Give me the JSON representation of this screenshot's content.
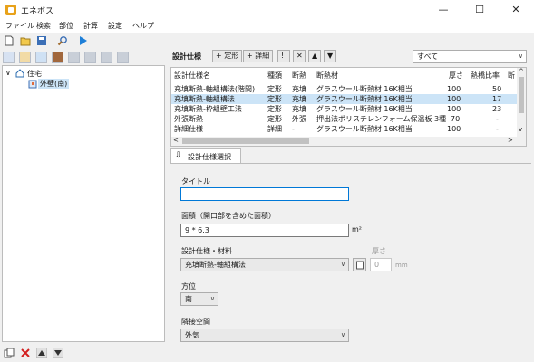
{
  "window": {
    "title": "エネボス",
    "min": "—",
    "max": "☐",
    "close": "✕"
  },
  "menu": [
    "ファイル",
    "検索",
    "部位",
    "計算",
    "設定",
    "ヘルプ"
  ],
  "tree": {
    "root": "住宅",
    "child": "外壁(南)"
  },
  "spec_header": {
    "title": "設計仕様",
    "add_fixed": "定形",
    "add_detail": "詳細",
    "filter_value": "すべて"
  },
  "table": {
    "columns": [
      "設計仕様名",
      "種類",
      "断熱",
      "断熱材",
      "厚さ",
      "熱橋比率",
      "断"
    ],
    "rows": [
      [
        "充填断熱-軸組構法(階間)",
        "定形",
        "充填",
        "グラスウール断熱材 16K相当",
        "100",
        "50"
      ],
      [
        "充填断熱-軸組構法",
        "定形",
        "充填",
        "グラスウール断熱材 16K相当",
        "100",
        "17"
      ],
      [
        "充填断熱-枠組壁工法",
        "定形",
        "充填",
        "グラスウール断熱材 16K相当",
        "100",
        "23"
      ],
      [
        "外張断熱",
        "定形",
        "外張",
        "押出法ポリスチレンフォーム保温板 3種",
        "70",
        "-"
      ],
      [
        "詳細仕様",
        "詳細",
        "-",
        "グラスウール断熱材 16K相当",
        "100",
        "-"
      ]
    ],
    "selected_index": 1
  },
  "select_tab": "設計仕様選択",
  "form": {
    "title_label": "タイトル",
    "title_value": "",
    "area_label": "面積（開口部を含めた面積）",
    "area_value": "9 * 6.3",
    "area_unit": "m²",
    "spec_label": "設計仕様・材料",
    "spec_value": "充填断熱-軸組構法",
    "thickness_label": "厚さ",
    "thickness_value": "0",
    "thickness_unit": "mm",
    "direction_label": "方位",
    "direction_value": "南",
    "adjacent_label": "隣接空間",
    "adjacent_value": "外気"
  }
}
